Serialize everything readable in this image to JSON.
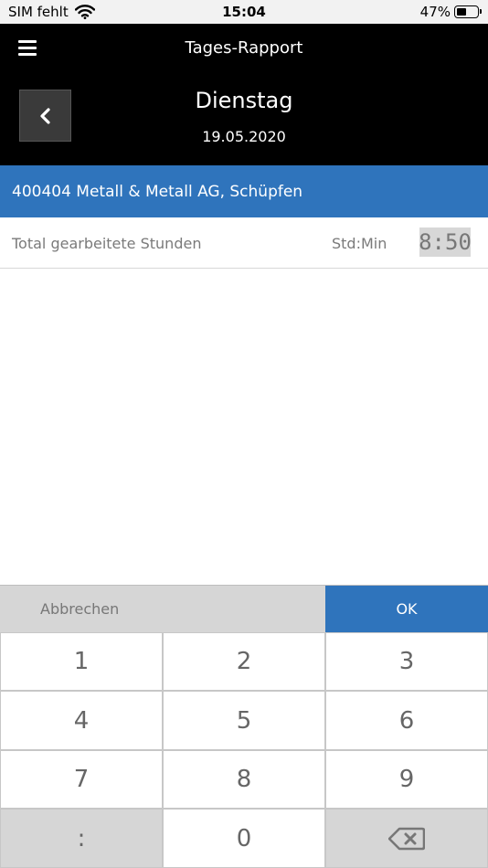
{
  "status_bar": {
    "carrier": "SIM fehlt",
    "time": "15:04",
    "battery": "47%"
  },
  "header": {
    "title": "Tages-Rapport",
    "day": "Dienstag",
    "date": "19.05.2020"
  },
  "customer": {
    "label": "400404 Metall & Metall  AG, Schüpfen"
  },
  "total": {
    "label": "Total gearbeitete Stunden",
    "unit": "Std:Min",
    "value": "8:50"
  },
  "keypad": {
    "cancel_label": "Abbrechen",
    "ok_label": "OK",
    "keys": [
      "1",
      "2",
      "3",
      "4",
      "5",
      "6",
      "7",
      "8",
      "9",
      ":",
      "0"
    ]
  },
  "colors": {
    "accent": "#2f74bc",
    "header_bg": "#000000"
  }
}
